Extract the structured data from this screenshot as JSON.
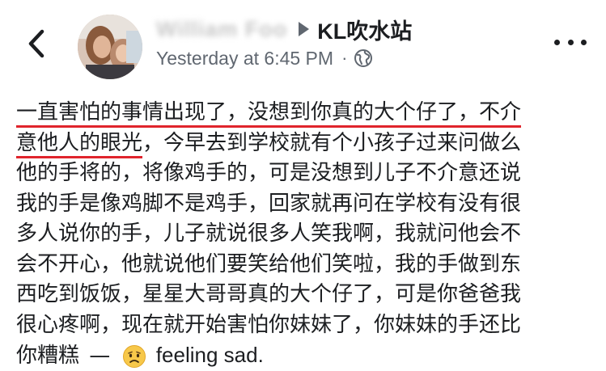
{
  "header": {
    "author_name": "William Foo",
    "group_name": "KL吹水站",
    "timestamp": "Yesterday at 6:45 PM",
    "separator": "·",
    "icons": {
      "back": "chevron-left-icon",
      "audience": "globe-icon",
      "more": "more-options-icon",
      "arrow": "triangle-right-icon"
    }
  },
  "post": {
    "line1_underlined": "一直害怕的事情出现了，没想到你真的大个仔了，不介",
    "line2_underlined": "意他人的眼光",
    "line2_rest": "，今早去到学校就有个小孩子过来问做么",
    "lines": [
      "他的手将的，将像鸡手的，可是没想到儿子不介意还说",
      "我的手是像鸡脚不是鸡手，回家就再问在学校有没有很",
      "多人说你的手，儿子就说很多人笑我啊，我就问他会不",
      "会不开心，他就说他们要笑给他们笑啦，我的手做到东",
      "西吃到饭饭，星星大哥哥真的大个仔了，可是你爸爸我",
      "很心疼啊，现在就开始害怕你妹妹了，你妹妹的手还比"
    ],
    "last_line_text": "你糟糕",
    "feeling_dash": "—",
    "feeling_label": "feeling sad.",
    "feeling_icon": "sad-face-icon"
  },
  "colors": {
    "underline": "#e0242c",
    "meta_text": "#606770",
    "body_text": "#1c1e21"
  }
}
